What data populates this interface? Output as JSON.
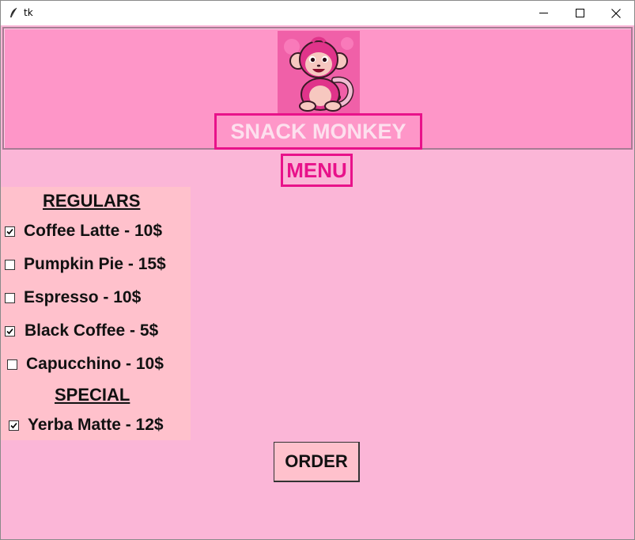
{
  "window": {
    "title": "tk"
  },
  "header": {
    "brand": "SNACK MONKEY"
  },
  "menu_title": "MENU",
  "regulars": {
    "heading": "REGULARS",
    "items": [
      {
        "label": "Coffee Latte - 10$",
        "checked": true
      },
      {
        "label": "Pumpkin Pie - 15$",
        "checked": false
      },
      {
        "label": "Espresso - 10$",
        "checked": false
      },
      {
        "label": "Black Coffee - 5$",
        "checked": true
      },
      {
        "label": "Capucchino - 10$",
        "checked": false
      }
    ]
  },
  "special": {
    "heading": "SPECIAL",
    "items": [
      {
        "label": "Yerba Matte - 12$",
        "checked": true
      }
    ]
  },
  "order_button": "ORDER",
  "colors": {
    "background": "#fbb6d7",
    "header_bg": "#fe96c8",
    "accent": "#e8128a",
    "panel_bg": "#ffc1cc"
  }
}
